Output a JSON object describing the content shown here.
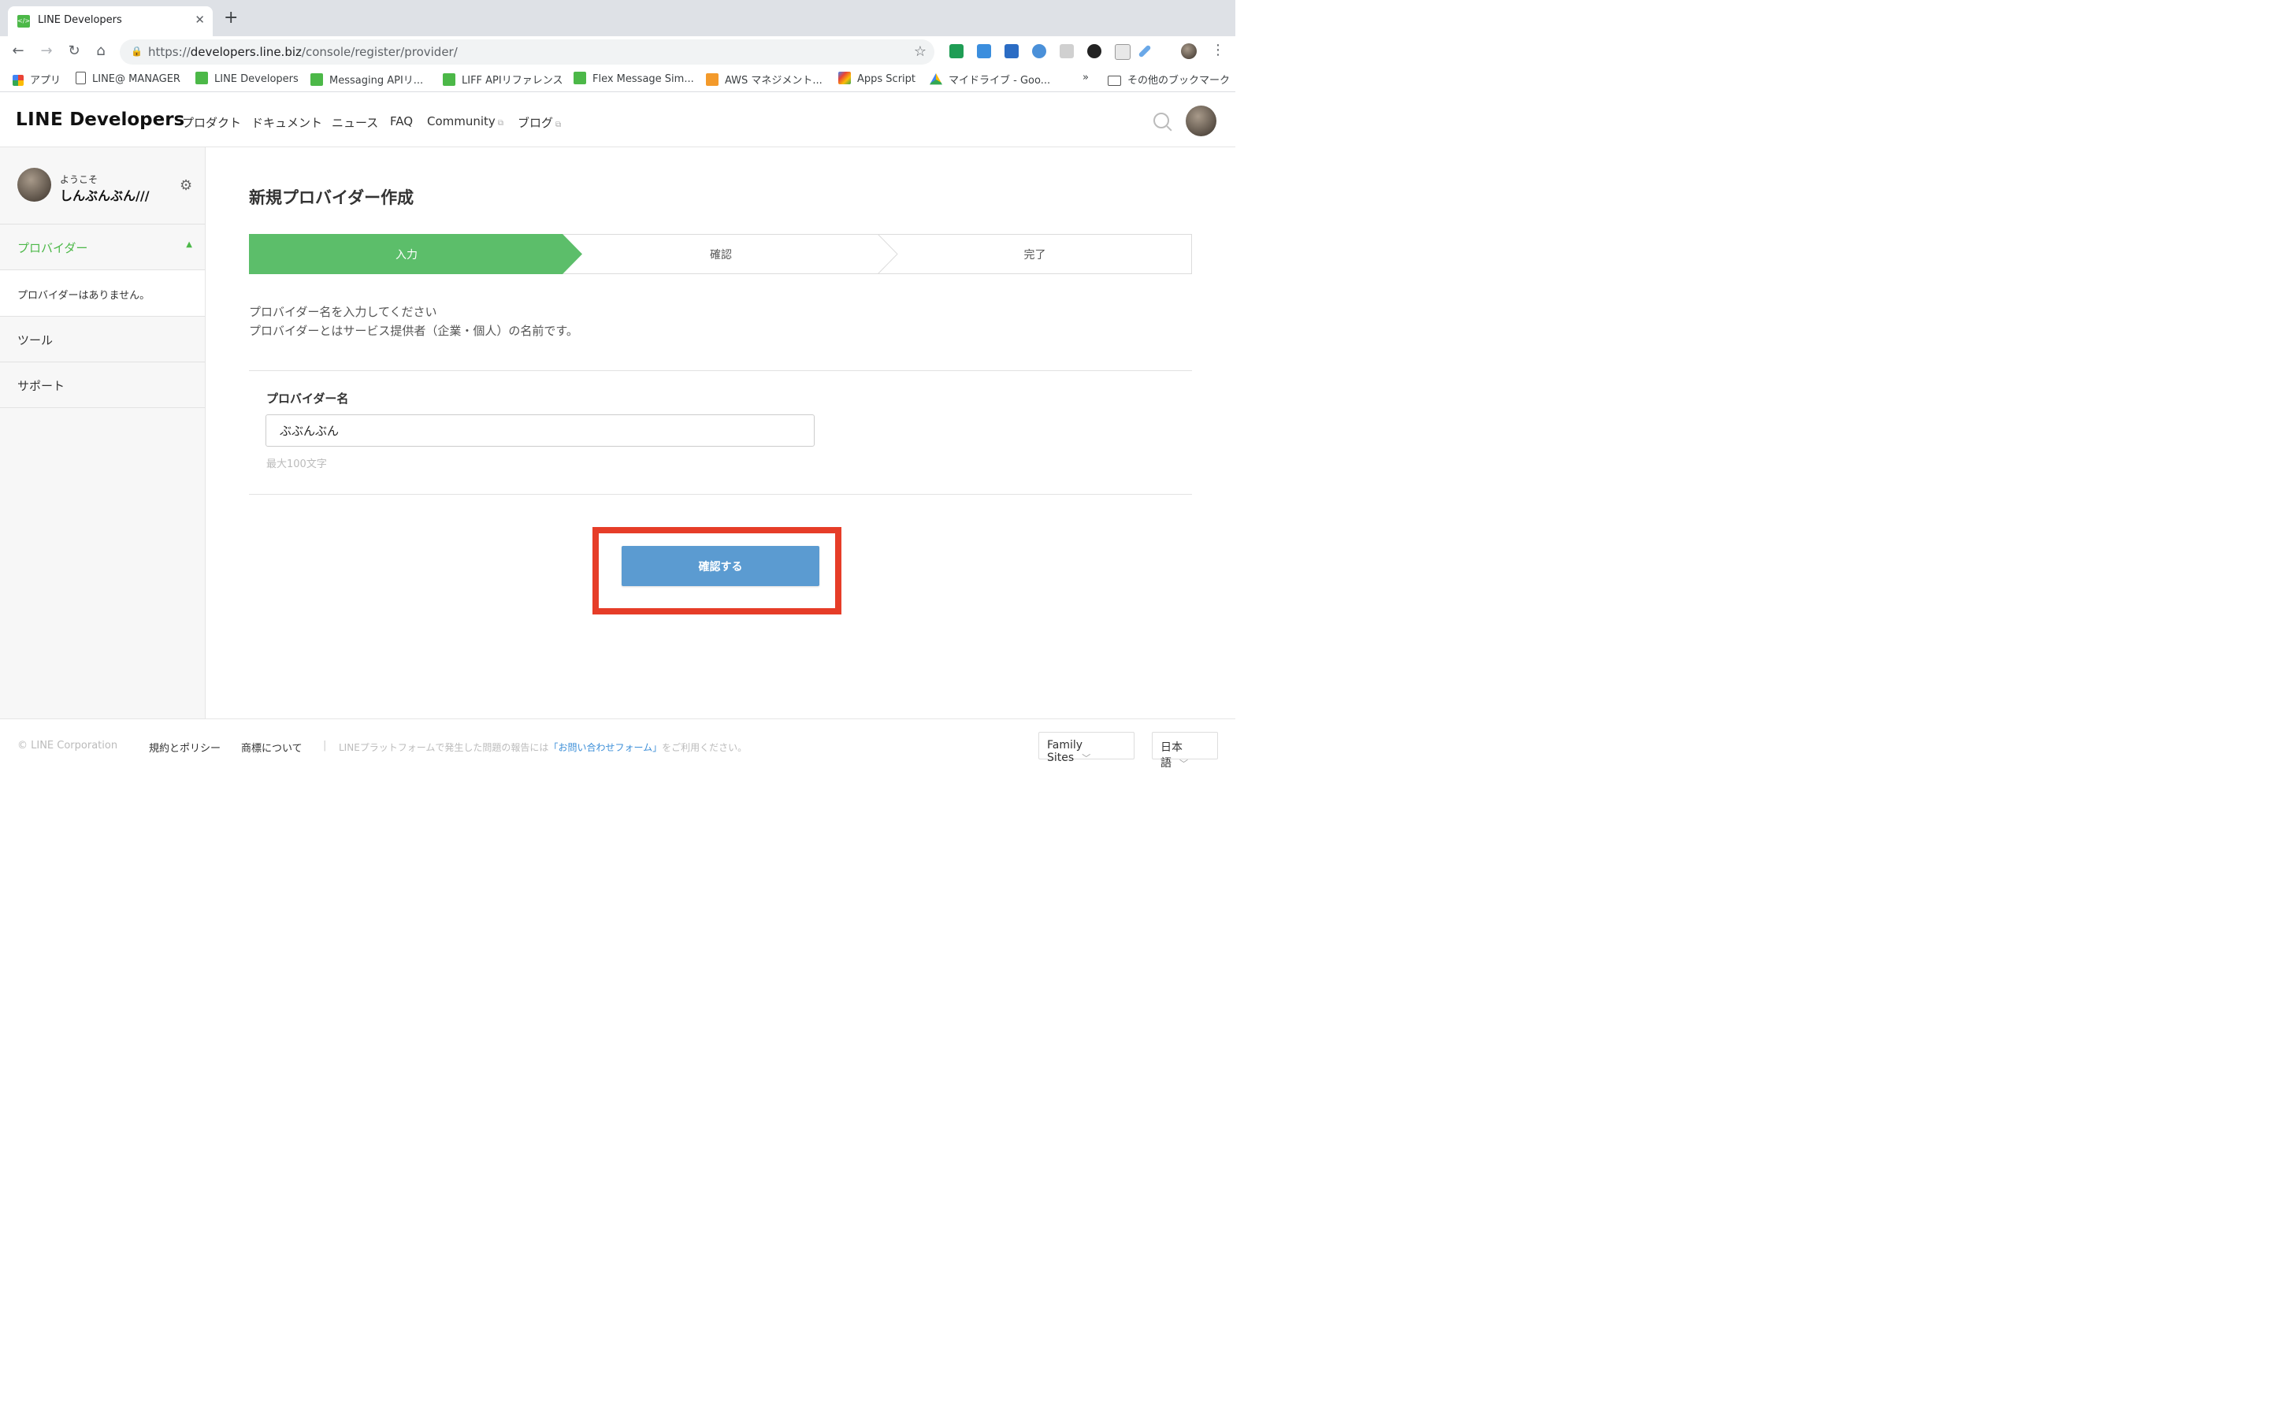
{
  "browser": {
    "tab_title": "LINE Developers",
    "tab_favicon": "</>",
    "url_scheme": "https://",
    "url_host": "developers.line.biz",
    "url_path": "/console/register/provider/",
    "bookmarks": [
      {
        "label": "アプリ",
        "icon": "apps-grid-icon"
      },
      {
        "label": "LINE@ MANAGER",
        "icon": "page-icon"
      },
      {
        "label": "LINE Developers",
        "icon": "line-dev-icon"
      },
      {
        "label": "Messaging APIリ...",
        "icon": "line-dev-icon"
      },
      {
        "label": "LIFF APIリファレンス",
        "icon": "line-dev-icon"
      },
      {
        "label": "Flex Message Sim...",
        "icon": "line-dev-icon"
      },
      {
        "label": "AWS マネジメント...",
        "icon": "aws-cube-icon"
      },
      {
        "label": "Apps Script",
        "icon": "apps-script-icon"
      },
      {
        "label": "マイドライブ - Goo...",
        "icon": "drive-icon"
      }
    ],
    "bookmarks_overflow": "»",
    "other_bookmarks": "その他のブックマーク"
  },
  "header": {
    "logo_line": "LINE",
    "logo_developers": "Developers",
    "nav": [
      "プロダクト",
      "ドキュメント",
      "ニュース",
      "FAQ",
      "Community",
      "ブログ"
    ]
  },
  "sidebar": {
    "welcome": "ようこそ",
    "username": "しんぶんぶん///",
    "provider_section": "プロバイダー",
    "no_providers": "プロバイダーはありません。",
    "tools": "ツール",
    "support": "サポート"
  },
  "main": {
    "title": "新規プロバイダー作成",
    "steps": [
      "入力",
      "確認",
      "完了"
    ],
    "active_step": 0,
    "description_line1": "プロバイダー名を入力してください",
    "description_line2": "プロバイダーとはサービス提供者（企業・個人）の名前です。",
    "field_label": "プロバイダー名",
    "field_value": "ぶぶんぶん",
    "field_hint": "最大100文字",
    "confirm_button": "確認する"
  },
  "footer": {
    "copyright": "© LINE Corporation",
    "terms": "規約とポリシー",
    "trademark": "商標について",
    "separator": "|",
    "report_prefix": "LINEプラットフォームで発生した問題の報告には",
    "report_link": "「お問い合わせフォーム」",
    "report_suffix": "をご利用ください。",
    "family_sites": "Family Sites",
    "language": "日本語"
  },
  "colors": {
    "accent_green": "#4cb848",
    "step_active": "#5cbe6a",
    "button_blue": "#5b9bd1",
    "highlight_red": "#e63d28"
  }
}
